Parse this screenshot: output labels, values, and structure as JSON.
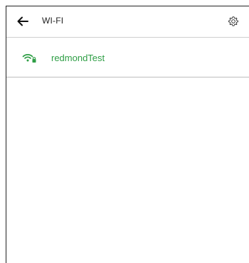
{
  "header": {
    "title": "WI-FI",
    "back_icon": "arrow-left-icon",
    "settings_icon": "gear-icon"
  },
  "networks": [
    {
      "name": "redmondTest",
      "icon": "wifi-locked-icon",
      "color": "#2e9e45"
    }
  ],
  "colors": {
    "accent": "#2e9e45",
    "text": "#222222",
    "divider": "#cfcfcf"
  }
}
